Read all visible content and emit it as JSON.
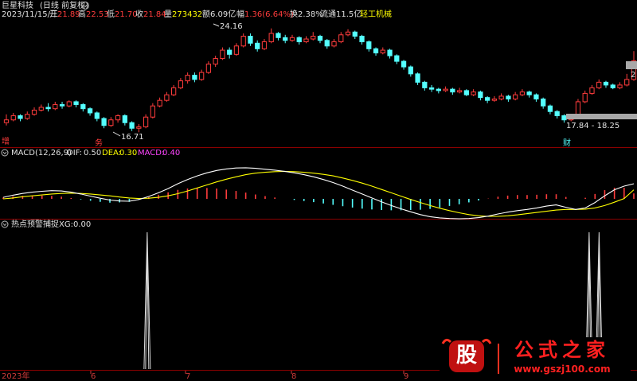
{
  "header": {
    "stock_name": "巨星科技",
    "period": "(日线 前复权)",
    "date": "2023/11/15/三",
    "open_label": "开",
    "open": "21.89",
    "high_label": "高",
    "high": "22.53",
    "low_label": "低",
    "low": "21.70",
    "close_label": "收",
    "close": "21.84",
    "volume_label": "量",
    "volume": "273432",
    "amount_label": "额",
    "amount": "6.09亿",
    "change_label": "幅",
    "change": "1.36(6.64%)",
    "turnover_label": "换",
    "turnover": "2.38%",
    "float_label": "流通",
    "float": "11.5亿",
    "industry": "轻工机械"
  },
  "price_panel": {
    "high_marker": "24.16",
    "low_marker": "16.71",
    "range_label": "17.84 - 18.25",
    "right_marker": "2",
    "badge_zeng": "增",
    "badge_wu": "务",
    "badge_cai": "财"
  },
  "macd_panel": {
    "title": "MACD(12,26,9)",
    "dif_label": "DIF:",
    "dif": "0.50",
    "dea_label": "DEA:",
    "dea": "0.30",
    "macd_label": "MACD:",
    "macd": "0.40"
  },
  "signal_panel": {
    "title": "热点预警捕捉",
    "xg_label": "XG:",
    "xg": "0.00"
  },
  "time_axis": {
    "labels": [
      "2023年",
      "6",
      "7",
      "8",
      "9"
    ]
  },
  "watermark": {
    "logo_char": "股",
    "brand": "公式之家",
    "url": "www.gszj100.com"
  },
  "colors": {
    "up": "#ff3c3c",
    "down": "#54ffff",
    "dif": "#ffffff",
    "dea": "#ffff00",
    "macd_text": "#ff44ff",
    "divider": "#8b0000",
    "axis_text": "#d03a3a",
    "brand": "#ff2020"
  },
  "chart_data": [
    {
      "type": "candlestick",
      "title": "巨星科技 (日线 前复权)",
      "candles": [
        [
          17.4,
          17.6,
          18.0,
          17.2
        ],
        [
          17.6,
          17.9,
          18.1,
          17.5
        ],
        [
          17.9,
          17.7,
          18.0,
          17.5
        ],
        [
          17.7,
          18.0,
          18.2,
          17.6
        ],
        [
          18.0,
          18.3,
          18.5,
          17.9
        ],
        [
          18.3,
          18.5,
          18.7,
          18.2
        ],
        [
          18.5,
          18.4,
          18.8,
          18.2
        ],
        [
          18.4,
          18.7,
          18.9,
          18.3
        ],
        [
          18.7,
          18.6,
          18.9,
          18.4
        ],
        [
          18.6,
          18.9,
          19.0,
          18.5
        ],
        [
          18.9,
          18.7,
          19.0,
          18.5
        ],
        [
          18.7,
          18.4,
          18.8,
          18.2
        ],
        [
          18.4,
          18.1,
          18.5,
          17.9
        ],
        [
          18.1,
          17.7,
          18.2,
          17.5
        ],
        [
          17.7,
          17.2,
          17.8,
          17.0
        ],
        [
          17.2,
          17.6,
          17.8,
          17.1
        ],
        [
          17.6,
          17.9,
          18.0,
          17.4
        ],
        [
          17.9,
          17.4,
          18.0,
          17.2
        ],
        [
          17.4,
          17.0,
          17.5,
          16.8
        ],
        [
          17.0,
          17.1,
          17.3,
          16.71
        ],
        [
          17.1,
          17.8,
          18.0,
          17.0
        ],
        [
          17.8,
          18.6,
          18.8,
          17.7
        ],
        [
          18.6,
          19.0,
          19.2,
          18.5
        ],
        [
          19.0,
          19.4,
          19.6,
          18.9
        ],
        [
          19.4,
          19.9,
          20.1,
          19.3
        ],
        [
          19.9,
          20.4,
          20.6,
          19.8
        ],
        [
          20.4,
          20.8,
          21.0,
          20.2
        ],
        [
          20.8,
          20.5,
          21.0,
          20.3
        ],
        [
          20.5,
          21.0,
          21.2,
          20.4
        ],
        [
          21.0,
          21.6,
          21.8,
          20.9
        ],
        [
          21.6,
          22.0,
          22.2,
          21.4
        ],
        [
          22.0,
          22.6,
          22.8,
          21.9
        ],
        [
          22.6,
          22.3,
          22.8,
          22.0
        ],
        [
          22.3,
          22.9,
          23.1,
          22.2
        ],
        [
          22.9,
          23.6,
          23.8,
          22.8
        ],
        [
          23.6,
          23.1,
          23.8,
          22.9
        ],
        [
          23.1,
          22.7,
          23.3,
          22.5
        ],
        [
          22.7,
          23.2,
          23.4,
          22.6
        ],
        [
          23.2,
          23.8,
          24.16,
          23.1
        ],
        [
          23.8,
          23.5,
          23.9,
          23.3
        ],
        [
          23.5,
          23.3,
          23.7,
          23.1
        ],
        [
          23.3,
          23.5,
          23.7,
          23.2
        ],
        [
          23.5,
          23.2,
          23.6,
          23.0
        ],
        [
          23.2,
          23.4,
          23.6,
          23.1
        ],
        [
          23.4,
          23.6,
          23.9,
          23.3
        ],
        [
          23.6,
          23.3,
          23.7,
          23.1
        ],
        [
          23.3,
          22.9,
          23.4,
          22.7
        ],
        [
          22.9,
          23.2,
          23.4,
          22.8
        ],
        [
          23.2,
          23.7,
          23.9,
          23.1
        ],
        [
          23.7,
          23.9,
          24.1,
          23.6
        ],
        [
          23.9,
          23.6,
          24.0,
          23.4
        ],
        [
          23.6,
          23.2,
          23.7,
          23.0
        ],
        [
          23.2,
          22.7,
          23.3,
          22.5
        ],
        [
          22.7,
          22.4,
          22.8,
          22.2
        ],
        [
          22.4,
          22.6,
          22.8,
          22.3
        ],
        [
          22.6,
          22.2,
          22.7,
          22.0
        ],
        [
          22.2,
          21.8,
          22.3,
          21.6
        ],
        [
          21.8,
          21.4,
          21.9,
          21.2
        ],
        [
          21.4,
          20.9,
          21.5,
          20.7
        ],
        [
          20.9,
          20.3,
          21.0,
          20.1
        ],
        [
          20.3,
          19.9,
          20.4,
          19.7
        ],
        [
          19.9,
          19.8,
          20.1,
          19.6
        ],
        [
          19.8,
          19.7,
          19.9,
          19.5
        ],
        [
          19.7,
          19.8,
          20.0,
          19.6
        ],
        [
          19.8,
          19.6,
          19.9,
          19.4
        ],
        [
          19.6,
          19.7,
          19.9,
          19.5
        ],
        [
          19.7,
          19.4,
          19.8,
          19.3
        ],
        [
          19.4,
          19.6,
          19.8,
          19.3
        ],
        [
          19.6,
          19.2,
          19.7,
          19.0
        ],
        [
          19.2,
          19.0,
          19.3,
          18.8
        ],
        [
          19.0,
          19.1,
          19.3,
          18.9
        ],
        [
          19.1,
          19.3,
          19.5,
          19.0
        ],
        [
          19.3,
          19.1,
          19.4,
          18.9
        ],
        [
          19.1,
          19.4,
          19.6,
          19.0
        ],
        [
          19.4,
          19.6,
          19.8,
          19.3
        ],
        [
          19.6,
          19.4,
          19.7,
          19.2
        ],
        [
          19.4,
          19.1,
          19.5,
          18.9
        ],
        [
          19.1,
          18.6,
          19.2,
          18.4
        ],
        [
          18.6,
          18.2,
          18.7,
          18.0
        ],
        [
          18.2,
          17.9,
          18.3,
          17.7
        ],
        [
          17.9,
          17.6,
          18.0,
          17.4
        ],
        [
          17.6,
          17.8,
          17.9,
          17.5
        ],
        [
          17.8,
          18.9,
          19.1,
          17.8
        ],
        [
          18.9,
          19.5,
          19.7,
          18.8
        ],
        [
          19.5,
          19.9,
          20.1,
          19.4
        ],
        [
          19.9,
          20.3,
          20.5,
          19.8
        ],
        [
          20.3,
          20.1,
          20.4,
          19.9
        ],
        [
          20.1,
          19.9,
          20.2,
          19.8
        ],
        [
          19.9,
          20.1,
          20.3,
          19.8
        ],
        [
          20.1,
          20.5,
          20.9,
          20.0
        ],
        [
          20.5,
          21.84,
          22.53,
          20.4
        ]
      ]
    },
    {
      "type": "macd",
      "title": "MACD(12,26,9)",
      "series": [
        {
          "name": "DIF",
          "values": [
            0.05,
            0.12,
            0.18,
            0.22,
            0.25,
            0.27,
            0.26,
            0.22,
            0.16,
            0.09,
            0.02,
            -0.04,
            -0.07,
            -0.08,
            -0.02,
            0.08,
            0.2,
            0.34,
            0.5,
            0.64,
            0.76,
            0.86,
            0.94,
            0.99,
            1.02,
            1.03,
            1.01,
            0.98,
            0.95,
            0.91,
            0.86,
            0.8,
            0.73,
            0.64,
            0.54,
            0.42,
            0.29,
            0.16,
            0.03,
            -0.1,
            -0.22,
            -0.33,
            -0.43,
            -0.52,
            -0.59,
            -0.63,
            -0.65,
            -0.66,
            -0.65,
            -0.62,
            -0.57,
            -0.5,
            -0.44,
            -0.39,
            -0.35,
            -0.3,
            -0.24,
            -0.2,
            -0.28,
            -0.35,
            -0.3,
            -0.12,
            0.1,
            0.3,
            0.42,
            0.5
          ]
        },
        {
          "name": "DEA",
          "values": [
            0.0,
            0.03,
            0.07,
            0.1,
            0.13,
            0.16,
            0.18,
            0.19,
            0.18,
            0.16,
            0.13,
            0.1,
            0.06,
            0.03,
            0.01,
            0.02,
            0.05,
            0.1,
            0.17,
            0.26,
            0.36,
            0.46,
            0.56,
            0.65,
            0.73,
            0.8,
            0.85,
            0.88,
            0.9,
            0.91,
            0.9,
            0.88,
            0.85,
            0.81,
            0.76,
            0.69,
            0.61,
            0.52,
            0.42,
            0.31,
            0.2,
            0.09,
            -0.02,
            -0.12,
            -0.22,
            -0.31,
            -0.39,
            -0.46,
            -0.52,
            -0.56,
            -0.58,
            -0.58,
            -0.56,
            -0.53,
            -0.49,
            -0.45,
            -0.41,
            -0.37,
            -0.35,
            -0.35,
            -0.34,
            -0.3,
            -0.22,
            -0.11,
            0.01,
            0.3
          ]
        },
        {
          "name": "MACD",
          "values": [
            0.1,
            0.18,
            0.22,
            0.24,
            0.24,
            0.22,
            0.16,
            0.06,
            -0.04,
            -0.14,
            -0.22,
            -0.28,
            -0.26,
            -0.22,
            -0.06,
            0.12,
            0.3,
            0.48,
            0.66,
            0.76,
            0.8,
            0.8,
            0.76,
            0.68,
            0.58,
            0.46,
            0.32,
            0.2,
            0.1,
            0.0,
            -0.08,
            -0.16,
            -0.24,
            -0.34,
            -0.44,
            -0.54,
            -0.64,
            -0.72,
            -0.78,
            -0.82,
            -0.84,
            -0.84,
            -0.82,
            -0.8,
            -0.74,
            -0.64,
            -0.52,
            -0.4,
            -0.26,
            -0.12,
            0.02,
            0.16,
            0.24,
            0.28,
            0.28,
            0.3,
            0.34,
            0.34,
            0.14,
            0.0,
            0.08,
            0.36,
            0.64,
            0.82,
            0.82,
            0.4
          ]
        }
      ]
    },
    {
      "type": "line",
      "title": "热点预警捕捉",
      "series": [
        {
          "name": "XG",
          "values": [
            0,
            0,
            0,
            0,
            0,
            0,
            0,
            0,
            0,
            0,
            0,
            0,
            0,
            0,
            0,
            0,
            0,
            0,
            0,
            0,
            0,
            0,
            0,
            0,
            0,
            0,
            0,
            0,
            0,
            1,
            0,
            0,
            0,
            0,
            0,
            0,
            0,
            0,
            0,
            0,
            0,
            0,
            0,
            0,
            0,
            0,
            0,
            0,
            0,
            0,
            0,
            0,
            0,
            0,
            0,
            0,
            0,
            0,
            0,
            0,
            0,
            0,
            0,
            0,
            0,
            0,
            0,
            0,
            0,
            0,
            0,
            0,
            0,
            0,
            0,
            0,
            0,
            0,
            0,
            0,
            0,
            0,
            0,
            0,
            0,
            0,
            0,
            0,
            0,
            0,
            0,
            0,
            0,
            0,
            0,
            0,
            0,
            0,
            0,
            0,
            0,
            0,
            0,
            0,
            0,
            0,
            0,
            0,
            0,
            0,
            0,
            0,
            0,
            0,
            0,
            0,
            0,
            0,
            1,
            0,
            1,
            0,
            0,
            0,
            0,
            0,
            0,
            0
          ]
        }
      ],
      "ylim": [
        0,
        1
      ]
    }
  ]
}
